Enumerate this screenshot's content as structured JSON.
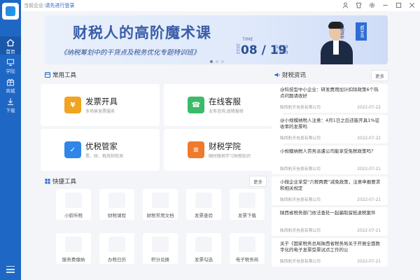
{
  "sidebar": {
    "items": [
      {
        "label": "首页",
        "icon": "home-icon"
      },
      {
        "label": "学院",
        "icon": "monitor-icon"
      },
      {
        "label": "商城",
        "icon": "gift-icon"
      },
      {
        "label": "下载",
        "icon": "download-icon"
      }
    ]
  },
  "topbar": {
    "prefix": "当前企业:",
    "login_link": "请先进行登录",
    "icons": [
      "user-icon",
      "shirt-icon",
      "settings-icon",
      "minimize-icon",
      "maximize-icon",
      "close-icon"
    ]
  },
  "banner": {
    "title": "财税人的高阶魔术课",
    "subtitle": "《纳税筹划中的干货点及税务优化专题特训班》",
    "time_label": "TIME",
    "year": "2022",
    "date": "08 / 19",
    "time_start": "14:00",
    "time_end": "17:30",
    "speaker_role": "大咖讲师",
    "speaker_name": "郝宇亮"
  },
  "common_tools": {
    "title": "常用工具",
    "items": [
      {
        "title": "发票开具",
        "desc": "多场景发票服务",
        "icon": "invoice-icon",
        "color": "#f0a422"
      },
      {
        "title": "在线客服",
        "desc": "业务咨询,故障报修",
        "icon": "service-icon",
        "color": "#3bbb6a"
      },
      {
        "title": "优税管家",
        "desc": "票、财、税风险检测",
        "icon": "tax-manager-icon",
        "color": "#2f86e6"
      },
      {
        "title": "财税学院",
        "desc": "随时随地学习财税知识",
        "icon": "academy-icon",
        "color": "#ef7a2c"
      }
    ]
  },
  "quick_tools": {
    "title": "快捷工具",
    "more": "更多",
    "items": [
      {
        "label": "小航听税"
      },
      {
        "label": "财税课程"
      },
      {
        "label": "财税常用文档"
      },
      {
        "label": "发票查验"
      },
      {
        "label": "发票下载"
      },
      {
        "label": "服务费缴纳"
      },
      {
        "label": "办税日历"
      },
      {
        "label": "积分兑换"
      },
      {
        "label": "发票勾选"
      },
      {
        "label": "电子税务局"
      }
    ]
  },
  "news": {
    "title": "财税资讯",
    "more": "更多",
    "items": [
      {
        "title": "@科技型中小企业：研发费用加计扣除政策6个热点问题请收好",
        "source": "陕西航天信息有限公司",
        "date": "2022-07-22"
      },
      {
        "title": "@小规模纳税人注意：4月1日之后还能开具1%征收率的发票吗",
        "source": "陕西航天信息有限公司",
        "date": "2022-07-22"
      },
      {
        "title": "小规模纳税人劳务派遣公司能享受免税政策吗？",
        "source": "陕西航天信息有限公司",
        "date": "2022-07-21"
      },
      {
        "title": "小微企业享受“六税两费”减免政策，注意申报要求和相关规定",
        "source": "陕西航天信息有限公司",
        "date": "2022-07-21"
      },
      {
        "title": "陕西省税务部门依法查处一起骗取留抵退税案件",
        "source": "陕西航天信息有限公司",
        "date": "2022-07-21"
      },
      {
        "title": "关于《国家税务总局陕西省税务局关于开展全面数字化的电子发票受票试点工作的公",
        "source": "陕西航天信息有限公司",
        "date": "2022-07-21"
      }
    ]
  }
}
